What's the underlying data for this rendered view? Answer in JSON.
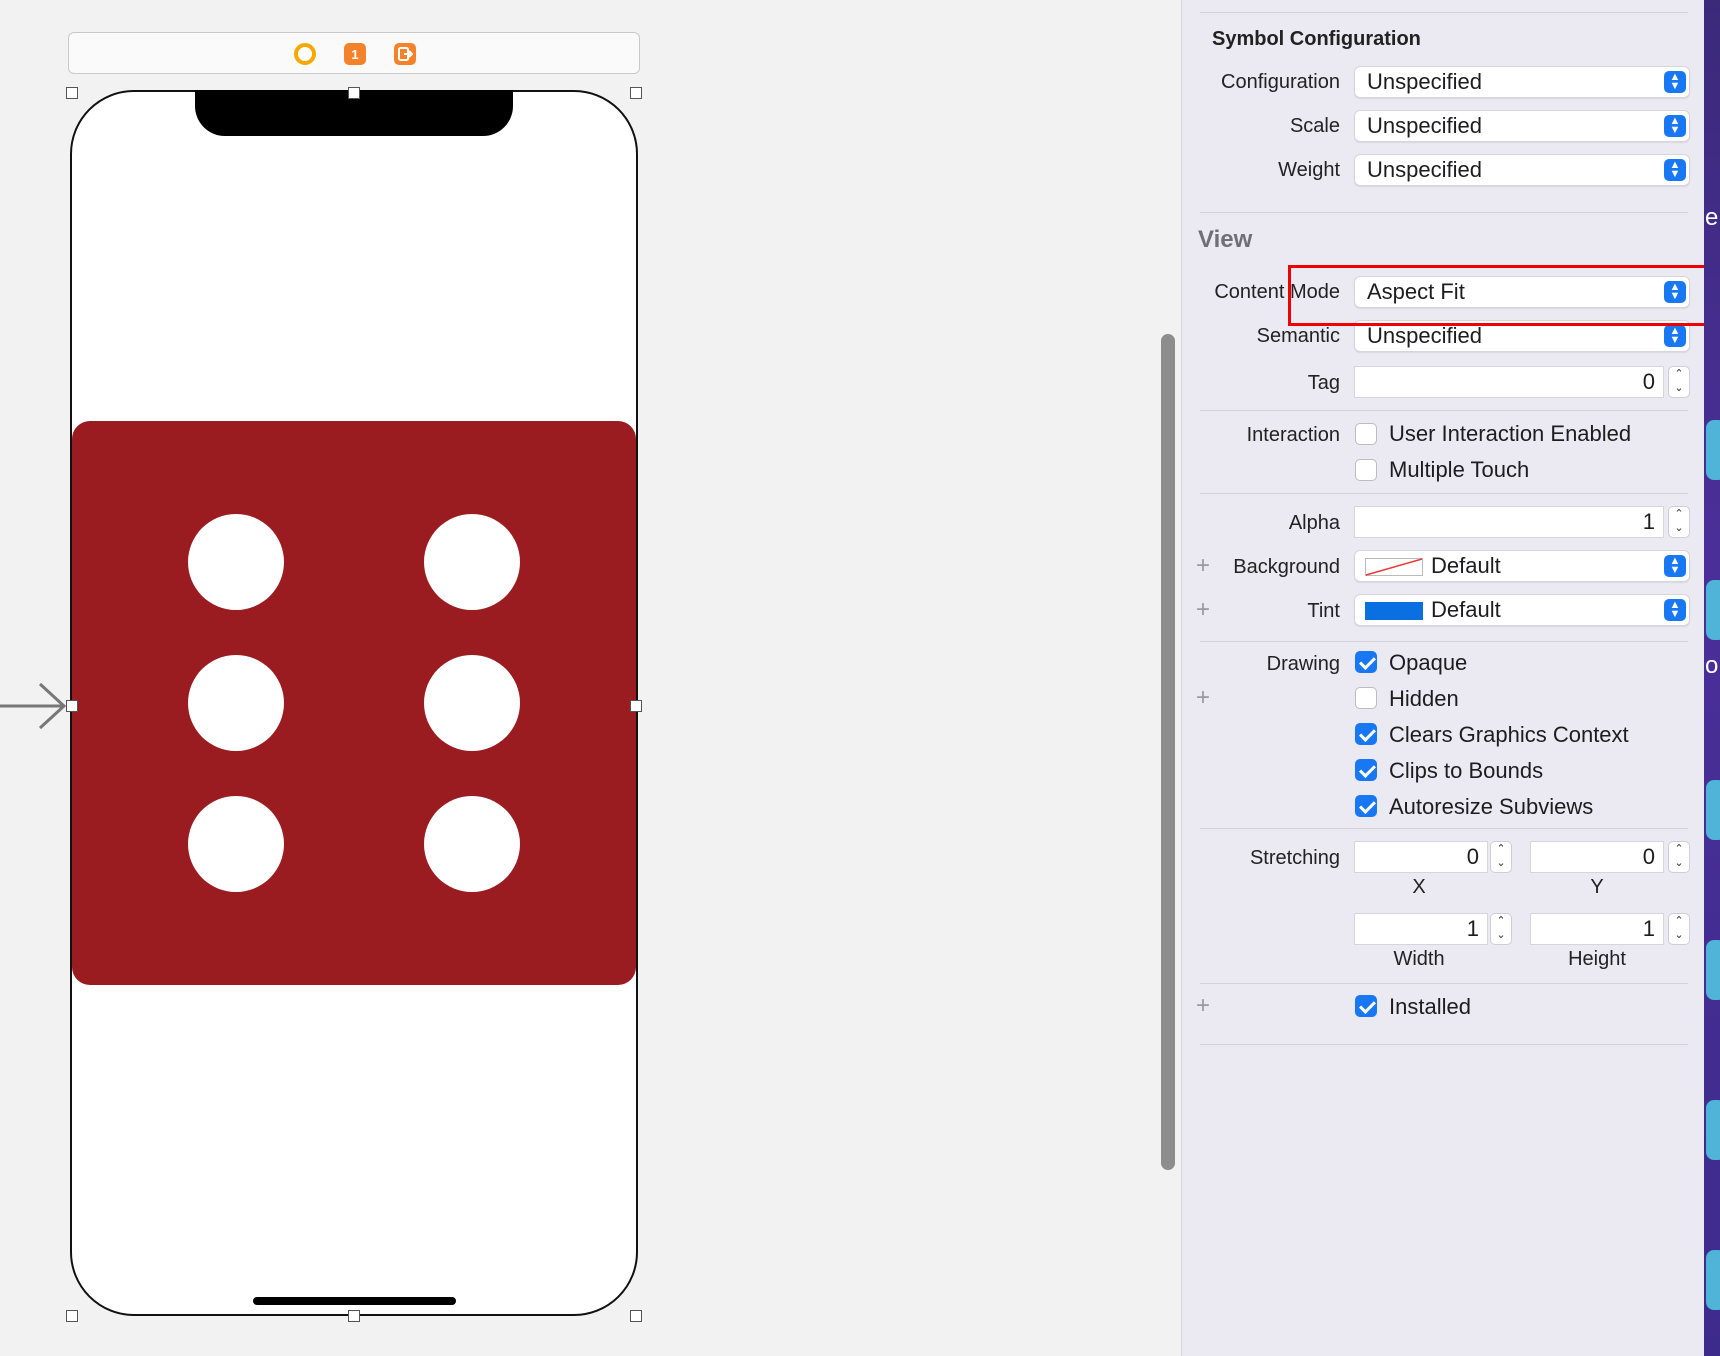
{
  "inspector": {
    "symbol_configuration": {
      "title": "Symbol Configuration",
      "configuration": {
        "label": "Configuration",
        "value": "Unspecified"
      },
      "scale": {
        "label": "Scale",
        "value": "Unspecified"
      },
      "weight": {
        "label": "Weight",
        "value": "Unspecified"
      }
    },
    "view": {
      "title": "View",
      "content_mode": {
        "label": "Content Mode",
        "value": "Aspect Fit"
      },
      "semantic": {
        "label": "Semantic",
        "value": "Unspecified"
      },
      "tag": {
        "label": "Tag",
        "value": "0"
      },
      "interaction": {
        "label": "Interaction",
        "user_interaction_enabled": {
          "label": "User Interaction Enabled",
          "checked": false
        },
        "multiple_touch": {
          "label": "Multiple Touch",
          "checked": false
        }
      },
      "alpha": {
        "label": "Alpha",
        "value": "1"
      },
      "background": {
        "label": "Background",
        "value": "Default"
      },
      "tint": {
        "label": "Tint",
        "value": "Default",
        "color": "#0a6fe0"
      },
      "drawing": {
        "label": "Drawing",
        "opaque": {
          "label": "Opaque",
          "checked": true
        },
        "hidden": {
          "label": "Hidden",
          "checked": false
        },
        "clears_graphics_context": {
          "label": "Clears Graphics Context",
          "checked": true
        },
        "clips_to_bounds": {
          "label": "Clips to Bounds",
          "checked": true
        },
        "autoresize_subviews": {
          "label": "Autoresize Subviews",
          "checked": true
        }
      },
      "stretching": {
        "label": "Stretching",
        "x": {
          "label": "X",
          "value": "0"
        },
        "y": {
          "label": "Y",
          "value": "0"
        },
        "width": {
          "label": "Width",
          "value": "1"
        },
        "height": {
          "label": "Height",
          "value": "1"
        }
      },
      "installed": {
        "label": "Installed",
        "checked": true
      }
    }
  },
  "canvas": {
    "dock": {
      "first_responder_badge": "1"
    },
    "dice": {
      "face_value": 6,
      "color": "#9a1c20"
    }
  },
  "desktop_edge": {
    "text_top": "er",
    "text_mid": "or"
  }
}
